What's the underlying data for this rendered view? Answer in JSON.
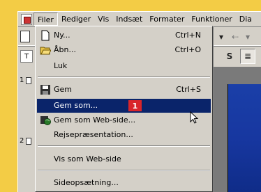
{
  "menubar": {
    "items": [
      "Filer",
      "Rediger",
      "Vis",
      "Indsæt",
      "Formater",
      "Funktioner",
      "Dia"
    ]
  },
  "toolbar": {
    "t_box": "T",
    "buttons": [
      "▾",
      "⇠",
      "▾",
      "S",
      "≣"
    ]
  },
  "left_pane": {
    "slide_numbers": [
      "1",
      "2"
    ]
  },
  "file_menu": {
    "items": [
      {
        "label": "Ny...",
        "shortcut": "Ctrl+N",
        "icon": "new-document-icon"
      },
      {
        "label": "Åbn...",
        "shortcut": "Ctrl+O",
        "icon": "open-folder-icon"
      },
      {
        "label": "Luk",
        "shortcut": "",
        "icon": ""
      },
      {
        "label": "Gem",
        "shortcut": "Ctrl+S",
        "icon": "save-disk-icon"
      },
      {
        "label": "Gem som...",
        "shortcut": "",
        "icon": "",
        "highlighted": true
      },
      {
        "label": "Gem som Web-side...",
        "shortcut": "",
        "icon": "save-web-icon"
      },
      {
        "label": "Rejsepræsentation...",
        "shortcut": "",
        "icon": ""
      },
      {
        "label": "Vis som Web-side",
        "shortcut": "",
        "icon": ""
      },
      {
        "label": "Sideopsætning...",
        "shortcut": "",
        "icon": ""
      }
    ],
    "step_badge": "1"
  },
  "colors": {
    "background": "#f3cc45",
    "highlight": "#0a246a",
    "badge": "#d9252a",
    "slide": "#1a3fa8"
  },
  "outline_letter": "r"
}
